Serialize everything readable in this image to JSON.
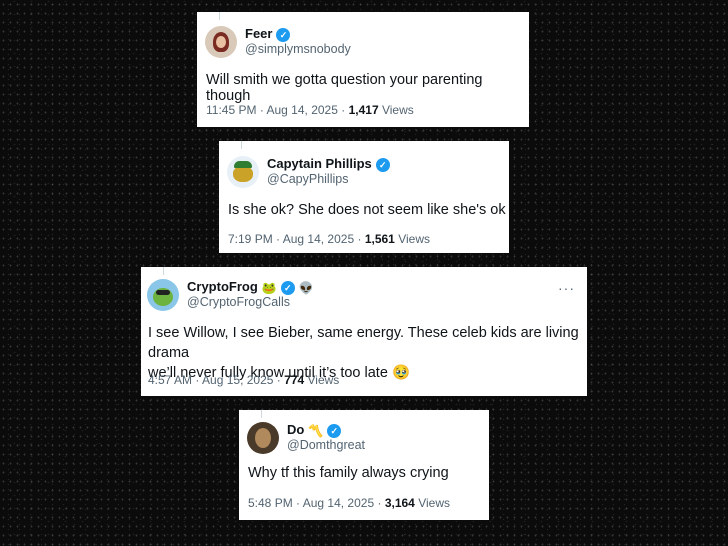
{
  "tweets": [
    {
      "display_name": "Feer",
      "handle": "@simplymsnobody",
      "text": "Will smith we gotta question your parenting though",
      "time": "11:45 PM",
      "date": "Aug 14, 2025",
      "views_count": "1,417",
      "views_label": "Views",
      "avatar_icon": "profile-photo-icon"
    },
    {
      "display_name": "Capytain Phillips",
      "handle": "@CapyPhillips",
      "text": "Is she ok? She does not seem like she's ok",
      "time": "7:19 PM",
      "date": "Aug 14, 2025",
      "views_count": "1,561",
      "views_label": "Views",
      "avatar_icon": "capybara-icon"
    },
    {
      "display_name": "CryptoFrog",
      "name_emoji": "🐸",
      "extra_badge": "👽",
      "handle": "@CryptoFrogCalls",
      "text_line1": "I see Willow, I see Bieber, same energy. These celeb kids are living drama",
      "text_line2": "we’ll never fully know until it’s too late",
      "text_emoji": "🥹",
      "time": "4:57 AM",
      "date": "Aug 15, 2025",
      "views_count": "774",
      "views_label": "Views",
      "more": "···",
      "avatar_icon": "frog-icon"
    },
    {
      "display_name": "Do",
      "name_emoji": "〽️",
      "handle": "@Domthgreat",
      "text": "Why tf this family always crying",
      "time": "5:48 PM",
      "date": "Aug 14, 2025",
      "views_count": "3,164",
      "views_label": "Views",
      "avatar_icon": "profile-photo-icon"
    }
  ],
  "meta_separator": "·",
  "verified_check": "✓",
  "colors": {
    "verified": "#1d9bf0",
    "secondary_text": "#536471",
    "primary_text": "#0f1419",
    "background": "#0b0b0b"
  }
}
